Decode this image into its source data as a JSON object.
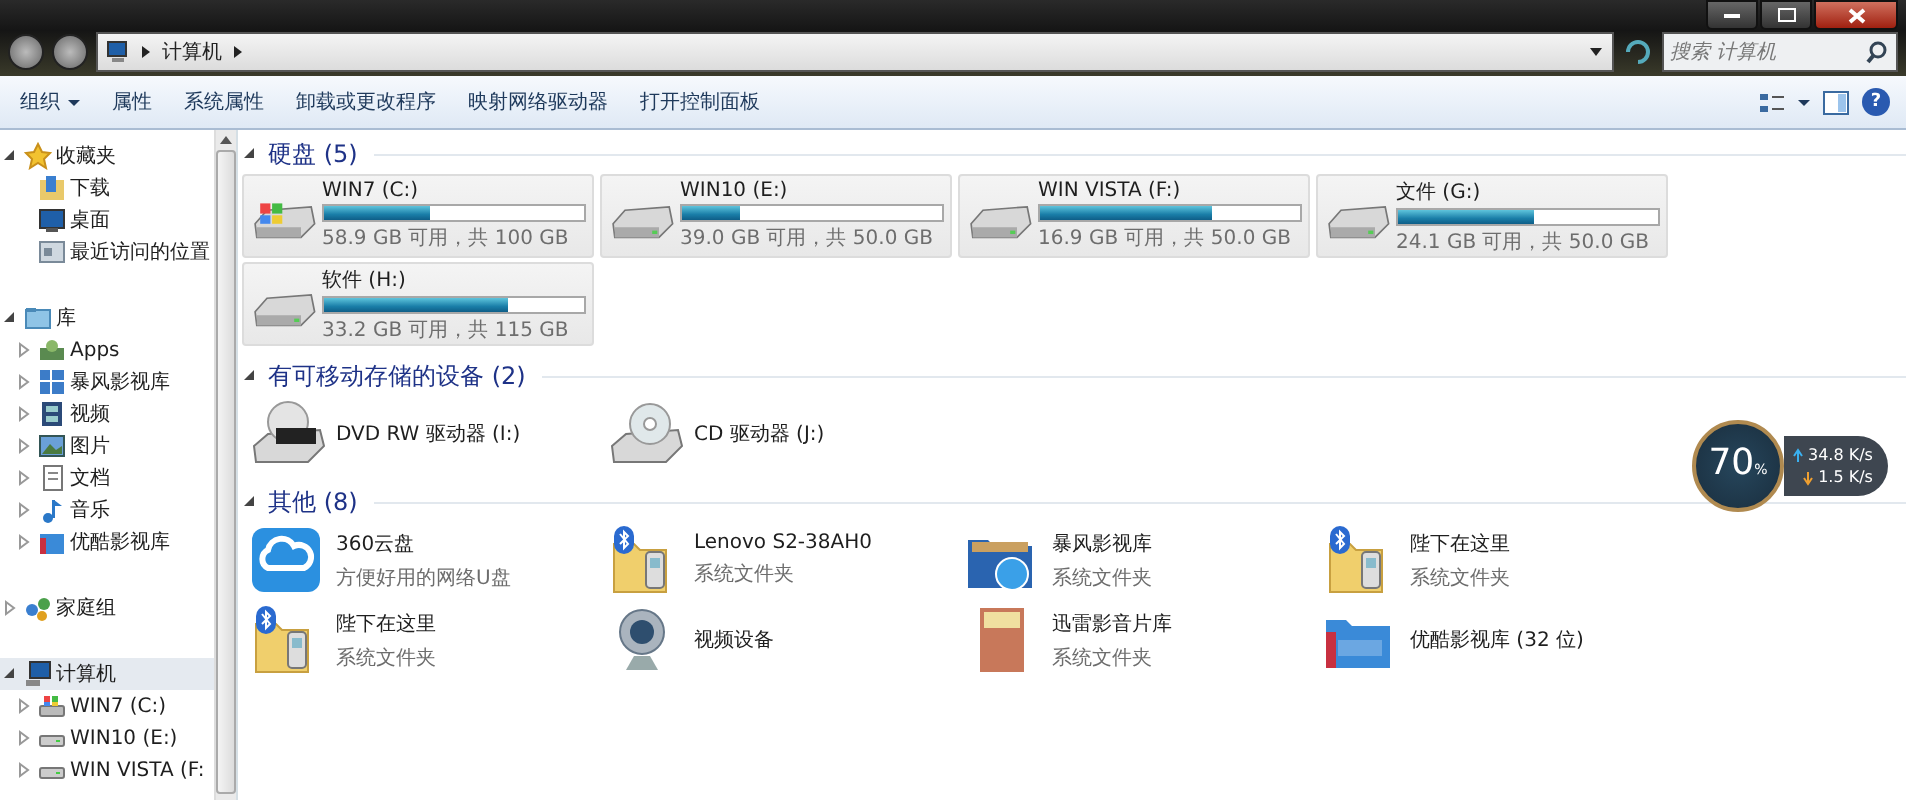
{
  "address_bar": {
    "path": [
      "计算机"
    ]
  },
  "search": {
    "placeholder": "搜索 计算机"
  },
  "toolbar": {
    "buttons": [
      {
        "label": "组织",
        "kind": "menu"
      },
      {
        "label": "属性",
        "kind": "plain"
      },
      {
        "label": "系统属性",
        "kind": "plain"
      },
      {
        "label": "卸载或更改程序",
        "kind": "plain"
      },
      {
        "label": "映射网络驱动器",
        "kind": "plain"
      },
      {
        "label": "打开控制面板",
        "kind": "plain"
      }
    ],
    "help_button": {
      "label": "?"
    }
  },
  "navigation": {
    "groups": [
      {
        "label": "收藏夹",
        "kind": "star",
        "expanded": true,
        "selected": false,
        "children": [
          {
            "label": "下载",
            "kind": "download",
            "selected": false
          },
          {
            "label": "桌面",
            "kind": "desktop",
            "selected": false
          },
          {
            "label": "最近访问的位置",
            "kind": "recent",
            "selected": false
          }
        ]
      },
      {
        "label": "库",
        "kind": "library",
        "expanded": true,
        "selected": false,
        "children": [
          {
            "label": "Apps",
            "kind": "apps",
            "expanded": false,
            "selected": false
          },
          {
            "label": "暴风影视库",
            "kind": "media",
            "expanded": false,
            "selected": false
          },
          {
            "label": "视频",
            "kind": "video",
            "expanded": false,
            "selected": false
          },
          {
            "label": "图片",
            "kind": "picture",
            "expanded": false,
            "selected": false
          },
          {
            "label": "文档",
            "kind": "document",
            "expanded": false,
            "selected": false
          },
          {
            "label": "音乐",
            "kind": "music",
            "expanded": false,
            "selected": false
          },
          {
            "label": "优酷影视库",
            "kind": "youku",
            "expanded": false,
            "selected": false
          }
        ]
      },
      {
        "label": "家庭组",
        "kind": "homegroup",
        "expanded": false,
        "selected": false
      },
      {
        "label": "计算机",
        "kind": "computer",
        "expanded": true,
        "selected": true,
        "children": [
          {
            "label": "WIN7 (C:)",
            "kind": "drive-windows",
            "expanded": false,
            "selected": false
          },
          {
            "label": "WIN10 (E:)",
            "kind": "drive",
            "expanded": false,
            "selected": false
          },
          {
            "label": "WIN  VISTA (F:",
            "kind": "drive",
            "expanded": false,
            "selected": false
          }
        ]
      }
    ]
  },
  "content": {
    "sections": [
      {
        "title": "硬盘 (5)",
        "kind": "tiles",
        "expanded": true,
        "items": [
          {
            "name": "WIN7 (C:)",
            "kind": "drive-windows",
            "level": 0.41,
            "detail": "58.9 GB 可用，共 100 GB"
          },
          {
            "name": "WIN10 (E:)",
            "kind": "drive",
            "level": 0.22,
            "detail": "39.0 GB 可用，共 50.0 GB"
          },
          {
            "name": "WIN  VISTA (F:)",
            "kind": "drive",
            "level": 0.66,
            "detail": "16.9 GB 可用，共 50.0 GB"
          },
          {
            "name": "文件 (G:)",
            "kind": "drive",
            "level": 0.52,
            "detail": "24.1 GB 可用，共 50.0 GB"
          },
          {
            "name": "软件 (H:)",
            "kind": "drive",
            "level": 0.71,
            "detail": "33.2 GB 可用，共 115 GB"
          }
        ]
      },
      {
        "title": "有可移动存储的设备 (2)",
        "kind": "icons",
        "expanded": true,
        "items": [
          {
            "name": "DVD RW 驱动器 (I:)",
            "kind": "dvd"
          },
          {
            "name": "CD 驱动器 (J:)",
            "kind": "cd"
          }
        ]
      },
      {
        "title": "其他 (8)",
        "kind": "icons",
        "expanded": true,
        "items": [
          {
            "name": "360云盘",
            "kind": "cloud",
            "detail": "方便好用的网络U盘"
          },
          {
            "name": "Lenovo S2-38AH0",
            "kind": "bluetooth",
            "detail": "系统文件夹"
          },
          {
            "name": "暴风影视库",
            "kind": "media",
            "detail": "系统文件夹"
          },
          {
            "name": "陛下在这里",
            "kind": "bluetooth",
            "detail": "系统文件夹"
          },
          {
            "name": "陛下在这里",
            "kind": "bluetooth",
            "detail": "系统文件夹"
          },
          {
            "name": "视频设备",
            "kind": "webcam"
          },
          {
            "name": "迅雷影音片库",
            "kind": "poster",
            "detail": "系统文件夹"
          },
          {
            "name": "优酷影视库 (32 位)",
            "kind": "youku"
          }
        ]
      }
    ]
  },
  "speed_widget": {
    "percent": "70",
    "unit": "%",
    "upload": "34.8 K/s",
    "download": "1.5 K/s"
  }
}
